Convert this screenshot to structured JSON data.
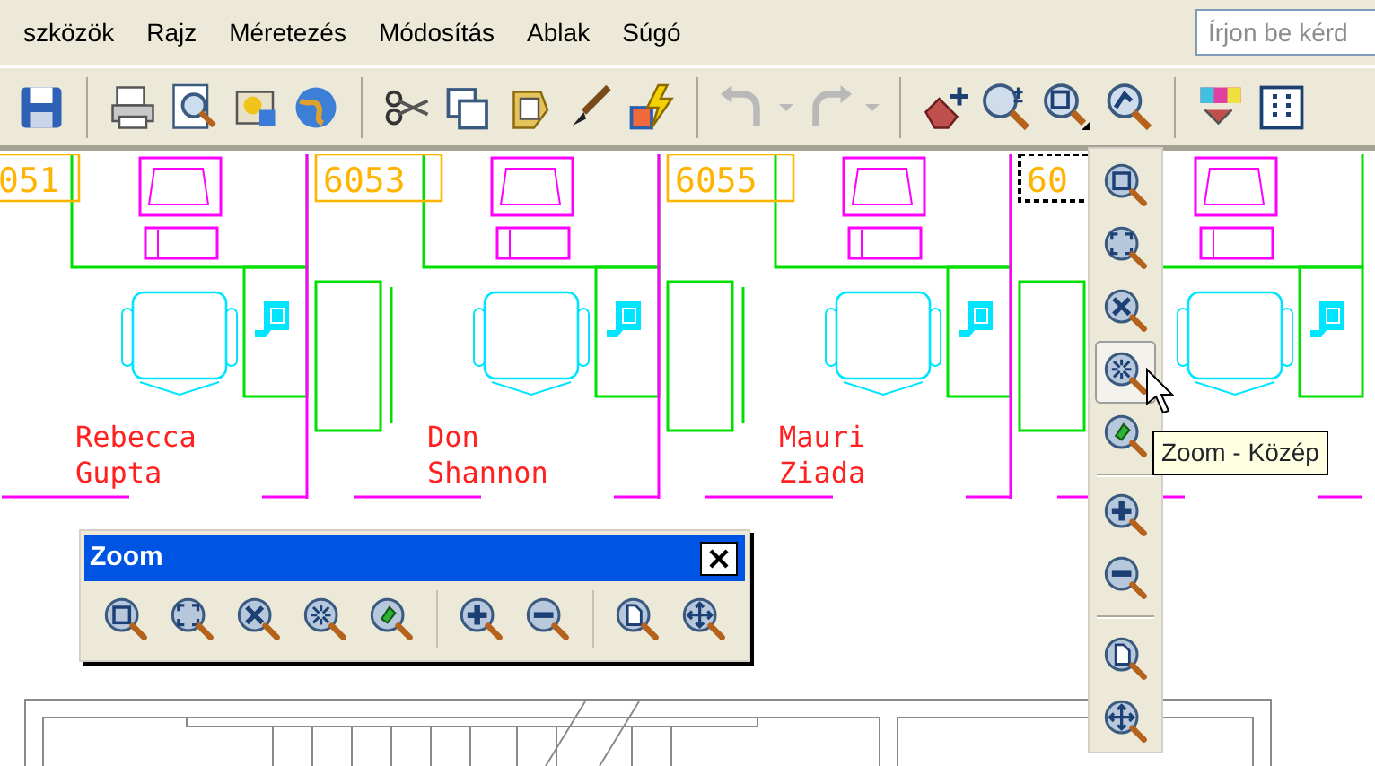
{
  "menu": [
    "szközök",
    "Rajz",
    "Méretezés",
    "Módosítás",
    "Ablak",
    "Súgó"
  ],
  "search": {
    "placeholder": "Írjon be kérd"
  },
  "rooms": [
    {
      "number": "051",
      "selected": false,
      "name": [
        "Rebecca",
        "Gupta"
      ]
    },
    {
      "number": "6053",
      "selected": false,
      "name": [
        "Don",
        "Shannon"
      ]
    },
    {
      "number": "6055",
      "selected": false,
      "name": [
        "Mauri",
        "Ziada"
      ]
    },
    {
      "number": "60",
      "selected": true
    }
  ],
  "flyout": {
    "buttons": [
      {
        "kind": "window",
        "selected": false
      },
      {
        "kind": "dynamic",
        "selected": false
      },
      {
        "kind": "scale",
        "selected": false
      },
      {
        "kind": "center",
        "selected": true
      },
      {
        "kind": "object",
        "selected": false
      },
      {
        "kind": "sep"
      },
      {
        "kind": "in",
        "selected": false
      },
      {
        "kind": "out",
        "selected": false
      },
      {
        "kind": "sep"
      },
      {
        "kind": "all",
        "selected": false
      },
      {
        "kind": "extents",
        "selected": false
      }
    ]
  },
  "tooltip": "Zoom - Közép",
  "zoom_toolbar": {
    "title": "Zoom",
    "buttons": [
      {
        "kind": "window"
      },
      {
        "kind": "dynamic"
      },
      {
        "kind": "scale"
      },
      {
        "kind": "center"
      },
      {
        "kind": "object"
      },
      {
        "kind": "sep"
      },
      {
        "kind": "in"
      },
      {
        "kind": "out"
      },
      {
        "kind": "sep"
      },
      {
        "kind": "all"
      },
      {
        "kind": "extents"
      }
    ]
  }
}
